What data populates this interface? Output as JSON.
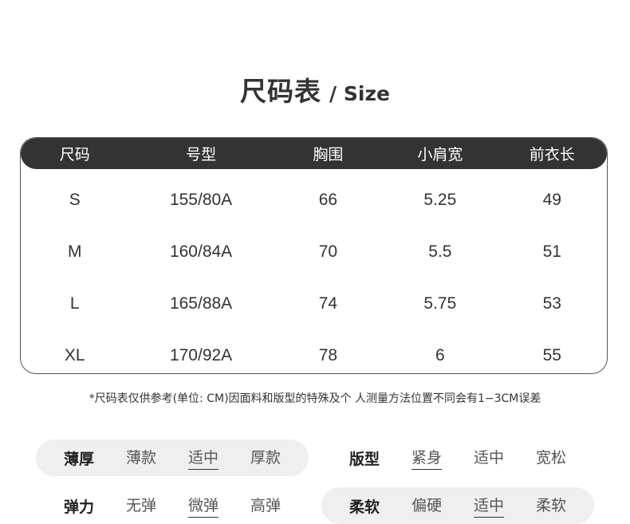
{
  "title": {
    "cn": "尺码表",
    "en": "/ Size"
  },
  "table": {
    "headers": [
      "尺码",
      "号型",
      "胸围",
      "小肩宽",
      "前衣长"
    ],
    "rows": [
      [
        "S",
        "155/80A",
        "66",
        "5.25",
        "49"
      ],
      [
        "M",
        "160/84A",
        "70",
        "5.5",
        "51"
      ],
      [
        "L",
        "165/88A",
        "74",
        "5.75",
        "53"
      ],
      [
        "XL",
        "170/92A",
        "78",
        "6",
        "55"
      ]
    ]
  },
  "note": "*尺码表仅供参考(单位: CM)因面料和版型的特殊及个 人测量方法位置不同会有1−3CM误差",
  "attributes": {
    "thickness": {
      "title": "薄厚",
      "options": [
        "薄款",
        "适中",
        "厚款"
      ],
      "selected": "适中"
    },
    "fit": {
      "title": "版型",
      "options": [
        "紧身",
        "适中",
        "宽松"
      ],
      "selected": "紧身"
    },
    "elasticity": {
      "title": "弹力",
      "options": [
        "无弹",
        "微弹",
        "高弹"
      ],
      "selected": "微弹"
    },
    "softness": {
      "title": "柔软",
      "options": [
        "偏硬",
        "适中",
        "柔软"
      ],
      "selected": "适中"
    }
  },
  "colors": {
    "header_bg": "#333333",
    "pill_bg": "#efefef",
    "text": "#333333"
  }
}
